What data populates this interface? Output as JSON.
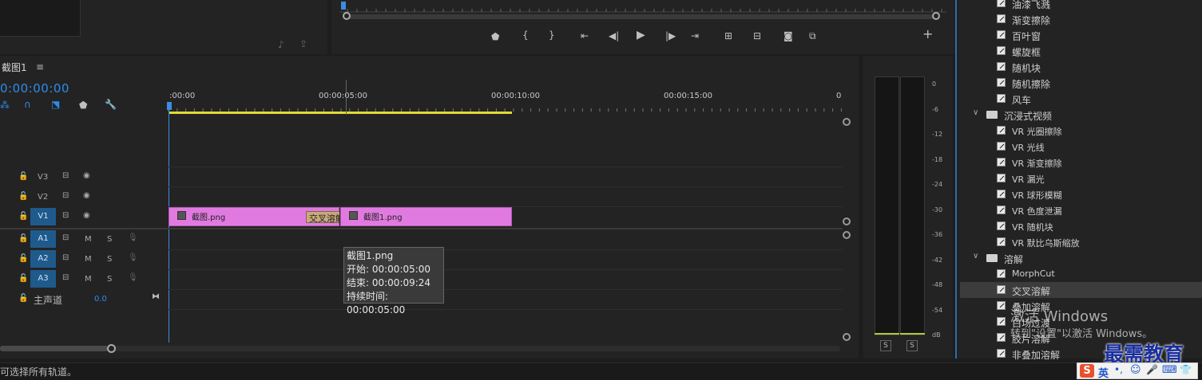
{
  "sequence": {
    "title": "截图1",
    "menu_icon": "hamburger-icon",
    "timecode": "0:00:00:00"
  },
  "ruler": {
    "labels": [
      ":00:00",
      "00:00:05:00",
      "00:00:10:00",
      "00:00:15:00",
      "0"
    ]
  },
  "tracks": {
    "video": [
      {
        "name": "V3"
      },
      {
        "name": "V2"
      },
      {
        "name": "V1"
      }
    ],
    "audio": [
      {
        "name": "A1",
        "m": "M",
        "s": "S"
      },
      {
        "name": "A2",
        "m": "M",
        "s": "S"
      },
      {
        "name": "A3",
        "m": "M",
        "s": "S"
      }
    ],
    "master": {
      "label": "主声道",
      "value": "0.0"
    }
  },
  "clips": {
    "clip1": "截图.png",
    "transition": "交叉溶解",
    "clip2": "截图1.png"
  },
  "tooltip": {
    "title": "截图1.png",
    "start": "开始: 00:00:05:00",
    "end": "结束: 00:00:09:24",
    "duration": "持续时间: 00:00:05:00"
  },
  "meter": {
    "ticks": [
      "0",
      "-6",
      "-12",
      "-18",
      "-24",
      "-30",
      "-36",
      "-42",
      "-48",
      "-54",
      "dB"
    ],
    "solo_left": "S",
    "solo_right": "S"
  },
  "effects": {
    "items": [
      {
        "label": "油漆飞溅",
        "type": "item"
      },
      {
        "label": "渐变擦除",
        "type": "item"
      },
      {
        "label": "百叶窗",
        "type": "item"
      },
      {
        "label": "螺旋框",
        "type": "item"
      },
      {
        "label": "随机块",
        "type": "item"
      },
      {
        "label": "随机擦除",
        "type": "item"
      },
      {
        "label": "风车",
        "type": "item"
      },
      {
        "label": "沉浸式视频",
        "type": "folder"
      },
      {
        "label": "VR 光圈擦除",
        "type": "item"
      },
      {
        "label": "VR 光线",
        "type": "item"
      },
      {
        "label": "VR 渐变擦除",
        "type": "item"
      },
      {
        "label": "VR 漏光",
        "type": "item"
      },
      {
        "label": "VR 球形模糊",
        "type": "item"
      },
      {
        "label": "VR 色度泄漏",
        "type": "item"
      },
      {
        "label": "VR 随机块",
        "type": "item"
      },
      {
        "label": "VR 默比乌斯缩放",
        "type": "item"
      },
      {
        "label": "溶解",
        "type": "folder"
      },
      {
        "label": "MorphCut",
        "type": "item"
      },
      {
        "label": "交叉溶解",
        "type": "item",
        "selected": true
      },
      {
        "label": "叠加溶解",
        "type": "item"
      },
      {
        "label": "白场过渡",
        "type": "item"
      },
      {
        "label": "胶片溶解",
        "type": "item"
      },
      {
        "label": "非叠加溶解",
        "type": "item"
      }
    ]
  },
  "watermark": {
    "line1": "激活 Windows",
    "line2": "转到\"设置\"以激活 Windows。",
    "brand": "最需教育"
  },
  "status": {
    "text": "可选择所有轨道。"
  },
  "ime": {
    "lang": "英",
    "logo": "S"
  }
}
